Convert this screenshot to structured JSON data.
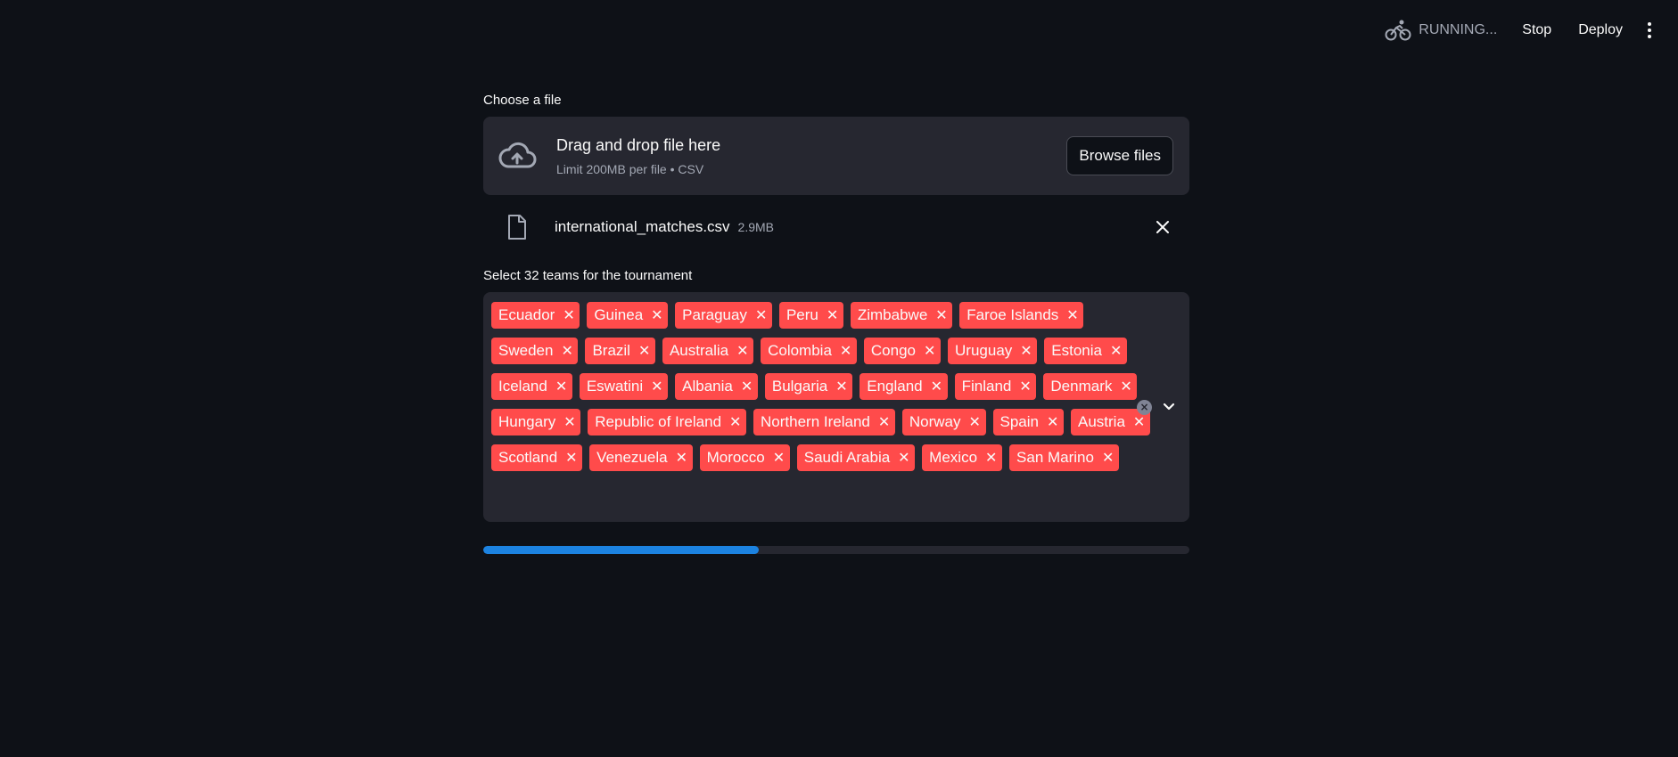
{
  "toolbar": {
    "status_icon": "cyclist-icon",
    "status_text": "RUNNING...",
    "stop_label": "Stop",
    "deploy_label": "Deploy",
    "menu_icon": "more-vert-icon"
  },
  "uploader": {
    "label": "Choose a file",
    "dropzone_title": "Drag and drop file here",
    "dropzone_subtitle": "Limit 200MB per file • CSV",
    "browse_label": "Browse files",
    "file": {
      "name": "international_matches.csv",
      "size": "2.9MB"
    }
  },
  "teams": {
    "label": "Select 32 teams for the tournament",
    "selected": [
      "Ecuador",
      "Guinea",
      "Paraguay",
      "Peru",
      "Zimbabwe",
      "Faroe Islands",
      "Sweden",
      "Brazil",
      "Australia",
      "Colombia",
      "Congo",
      "Uruguay",
      "Estonia",
      "Iceland",
      "Eswatini",
      "Albania",
      "Bulgaria",
      "England",
      "Finland",
      "Denmark",
      "Hungary",
      "Republic of Ireland",
      "Northern Ireland",
      "Norway",
      "Spain",
      "Austria",
      "Scotland",
      "Venezuela",
      "Morocco",
      "Saudi Arabia",
      "Mexico",
      "San Marino"
    ]
  },
  "progress": {
    "fraction": 0.39,
    "color": "#1c83e1"
  },
  "colors": {
    "background": "#0e1117",
    "tag": "#ff4b4b",
    "panel": "#262730"
  }
}
